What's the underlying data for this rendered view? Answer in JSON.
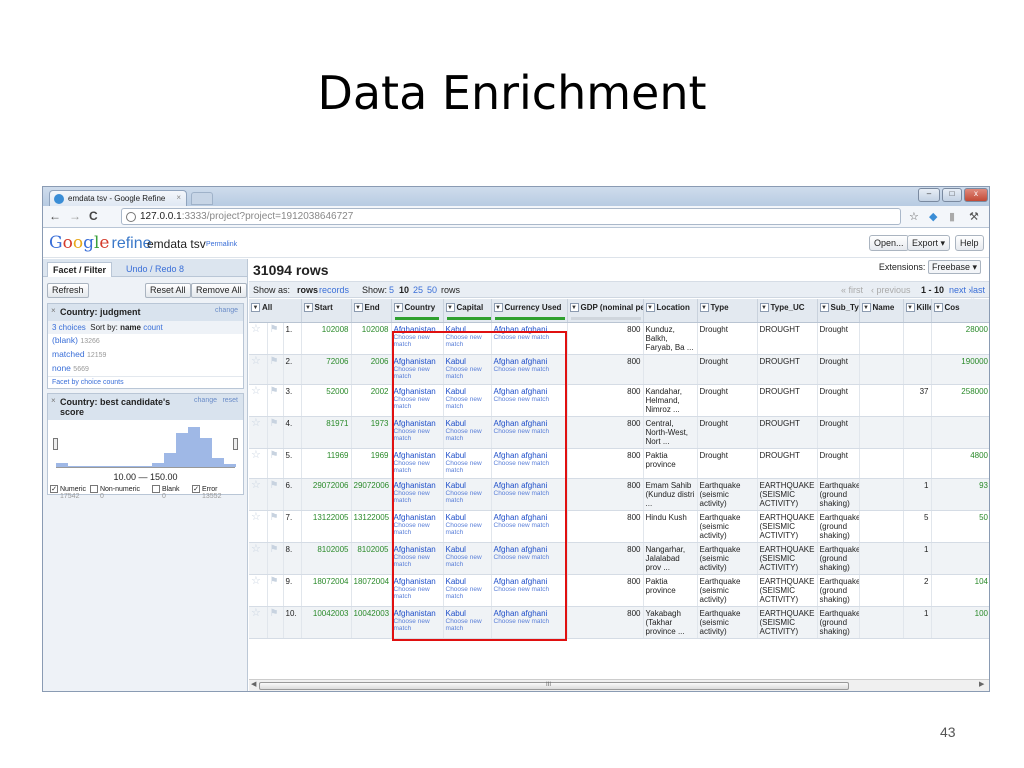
{
  "slide": {
    "title": "Data Enrichment",
    "number": "43"
  },
  "browser": {
    "tab_title": "emdata tsv - Google Refine",
    "tab_close": "×",
    "url_host": "127.0.0.1",
    "url_rest": ":3333/project?project=1912038646727",
    "win_min": "–",
    "win_max": "□",
    "win_close": "x",
    "back": "←",
    "forward": "→",
    "reload": "C",
    "star": "☆",
    "wrench": "⚒"
  },
  "refine": {
    "logo_letters": [
      "G",
      "o",
      "o",
      "g",
      "l",
      "e"
    ],
    "logo_refine": "refine",
    "project_name": "emdata tsv",
    "permalink": "Permalink",
    "open": "Open...",
    "export": "Export ▾",
    "help": "Help"
  },
  "left": {
    "tab_facet": "Facet / Filter",
    "tab_undo": "Undo / Redo 8",
    "refresh": "Refresh",
    "reset_all": "Reset All",
    "remove_all": "Remove All",
    "facet1": {
      "close": "×",
      "title": "Country: judgment",
      "change": "change",
      "choices": "3 choices",
      "sort_by": "Sort by:",
      "sort_name": "name",
      "sort_count": "count",
      "rows": [
        {
          "label": "(blank)",
          "count": "13266"
        },
        {
          "label": "matched",
          "count": "12159"
        },
        {
          "label": "none",
          "count": "5669"
        }
      ],
      "footer": "Facet by choice counts"
    },
    "facet2": {
      "close": "×",
      "title": "Country: best candidate's score",
      "change": "change",
      "reset": "reset",
      "histogram": [
        3,
        1,
        1,
        1,
        1,
        1,
        1,
        1,
        3,
        10,
        24,
        28,
        20,
        6,
        2
      ],
      "range": "10.00 — 150.00",
      "checks": [
        {
          "label": "Numeric",
          "checked": true,
          "count": "17542"
        },
        {
          "label": "Non-numeric",
          "checked": false,
          "count": "0"
        },
        {
          "label": "Blank",
          "checked": false,
          "count": "0"
        },
        {
          "label": "Error",
          "checked": true,
          "count": "13552"
        }
      ]
    }
  },
  "main": {
    "rows_title": "31094 rows",
    "extensions_label": "Extensions:",
    "extensions_value": "Freebase ▾",
    "show_as": "Show as:",
    "show_rows": "rows",
    "show_records": "records",
    "show_label": "Show:",
    "page_sizes": [
      "5",
      "10",
      "25",
      "50"
    ],
    "rows_word": "rows",
    "first": "« first",
    "previous": "‹ previous",
    "page_range": "1 - 10",
    "next": "next ›",
    "last": "last »",
    "columns": [
      "All",
      "Start",
      "End",
      "Country",
      "Capital",
      "Currency Used",
      "GDP (nominal per",
      "Location",
      "Type",
      "Type_UC",
      "Sub_Type",
      "Name",
      "Killed",
      "Cos"
    ],
    "choose_new_match": "Choose new match",
    "rows": [
      {
        "idx": "1.",
        "start": "102008",
        "end": "102008",
        "country": "Afghanistan",
        "capital": "Kabul",
        "currency": "Afghan afghani",
        "gdp": "800",
        "location": "Kunduz, Balkh, Faryab, Ba ...",
        "type": "Drought",
        "type_uc": "DROUGHT",
        "sub_type": "Drought",
        "name": "",
        "killed": "",
        "cos": "28000"
      },
      {
        "idx": "2.",
        "start": "72006",
        "end": "2006",
        "country": "Afghanistan",
        "capital": "Kabul",
        "currency": "Afghan afghani",
        "gdp": "800",
        "location": "",
        "type": "Drought",
        "type_uc": "DROUGHT",
        "sub_type": "Drought",
        "name": "",
        "killed": "",
        "cos": "190000"
      },
      {
        "idx": "3.",
        "start": "52000",
        "end": "2002",
        "country": "Afghanistan",
        "capital": "Kabul",
        "currency": "Afghan afghani",
        "gdp": "800",
        "location": "Kandahar, Helmand, Nimroz ...",
        "type": "Drought",
        "type_uc": "DROUGHT",
        "sub_type": "Drought",
        "name": "",
        "killed": "37",
        "cos": "258000"
      },
      {
        "idx": "4.",
        "start": "81971",
        "end": "1973",
        "country": "Afghanistan",
        "capital": "Kabul",
        "currency": "Afghan afghani",
        "gdp": "800",
        "location": "Central, North-West, Nort ...",
        "type": "Drought",
        "type_uc": "DROUGHT",
        "sub_type": "Drought",
        "name": "",
        "killed": "",
        "cos": ""
      },
      {
        "idx": "5.",
        "start": "11969",
        "end": "1969",
        "country": "Afghanistan",
        "capital": "Kabul",
        "currency": "Afghan afghani",
        "gdp": "800",
        "location": "Paktia province",
        "type": "Drought",
        "type_uc": "DROUGHT",
        "sub_type": "Drought",
        "name": "",
        "killed": "",
        "cos": "4800"
      },
      {
        "idx": "6.",
        "start": "29072006",
        "end": "29072006",
        "country": "Afghanistan",
        "capital": "Kabul",
        "currency": "Afghan afghani",
        "gdp": "800",
        "location": "Emam Sahib (Kunduz distri ...",
        "type": "Earthquake (seismic activity)",
        "type_uc": "EARTHQUAKE (SEISMIC ACTIVITY)",
        "sub_type": "Earthquake (ground shaking)",
        "name": "",
        "killed": "1",
        "cos": "93"
      },
      {
        "idx": "7.",
        "start": "13122005",
        "end": "13122005",
        "country": "Afghanistan",
        "capital": "Kabul",
        "currency": "Afghan afghani",
        "gdp": "800",
        "location": "Hindu Kush",
        "type": "Earthquake (seismic activity)",
        "type_uc": "EARTHQUAKE (SEISMIC ACTIVITY)",
        "sub_type": "Earthquake (ground shaking)",
        "name": "",
        "killed": "5",
        "cos": "50"
      },
      {
        "idx": "8.",
        "start": "8102005",
        "end": "8102005",
        "country": "Afghanistan",
        "capital": "Kabul",
        "currency": "Afghan afghani",
        "gdp": "800",
        "location": "Nangarhar, Jalalabad prov ...",
        "type": "Earthquake (seismic activity)",
        "type_uc": "EARTHQUAKE (SEISMIC ACTIVITY)",
        "sub_type": "Earthquake (ground shaking)",
        "name": "",
        "killed": "1",
        "cos": ""
      },
      {
        "idx": "9.",
        "start": "18072004",
        "end": "18072004",
        "country": "Afghanistan",
        "capital": "Kabul",
        "currency": "Afghan afghani",
        "gdp": "800",
        "location": "Paktia province",
        "type": "Earthquake (seismic activity)",
        "type_uc": "EARTHQUAKE (SEISMIC ACTIVITY)",
        "sub_type": "Earthquake (ground shaking)",
        "name": "",
        "killed": "2",
        "cos": "104"
      },
      {
        "idx": "10.",
        "start": "10042003",
        "end": "10042003",
        "country": "Afghanistan",
        "capital": "Kabul",
        "currency": "Afghan afghani",
        "gdp": "800",
        "location": "Yakabagh (Takhar province ...",
        "type": "Earthquake (seismic activity)",
        "type_uc": "EARTHQUAKE (SEISMIC ACTIVITY)",
        "sub_type": "Earthquake (ground shaking)",
        "name": "",
        "killed": "1",
        "cos": "100"
      }
    ],
    "scroll_mark": "III"
  }
}
